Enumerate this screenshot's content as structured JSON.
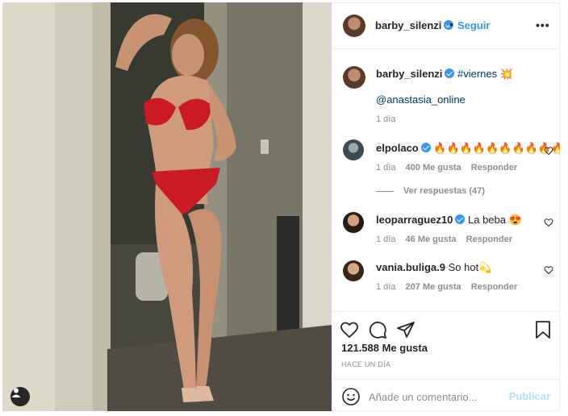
{
  "post": {
    "author": "barby_silenzi",
    "follow_label": "Seguir",
    "separator": "•",
    "more_label": "•••"
  },
  "caption": {
    "author": "barby_silenzi",
    "text": "#viernes 💥",
    "mention": "@anastasia_online",
    "age": "1 día"
  },
  "comments": [
    {
      "user": "elpolaco",
      "text": "🔥🔥🔥🔥🔥🔥🔥🔥🔥🔥",
      "age": "1 día",
      "likes": "400 Me gusta",
      "reply": "Responder",
      "verified": true
    },
    {
      "user": "leoparraguez10",
      "text": "La beba 😍",
      "age": "1 día",
      "likes": "46 Me gusta",
      "reply": "Responder",
      "verified": true
    },
    {
      "user": "vania.buliga.9",
      "text": "So hot💫",
      "age": "1 día",
      "likes": "207 Me gusta",
      "reply": "Responder",
      "verified": false
    }
  ],
  "view_replies": "Ver respuestas (47)",
  "likes_count": "121.588 Me gusta",
  "timestamp": "HACE UN DÍA",
  "comment_placeholder": "Añade un comentario...",
  "publish_label": "Publicar",
  "icons": [
    "heart-icon",
    "comment-icon",
    "share-icon",
    "bookmark-icon",
    "emoji-icon",
    "user-tag-icon",
    "verified-icon",
    "more-icon"
  ],
  "colors": {
    "accent": "#3897f0",
    "link": "#00376b",
    "muted": "#8e8e8e",
    "publish_disabled": "#b2dffc"
  }
}
